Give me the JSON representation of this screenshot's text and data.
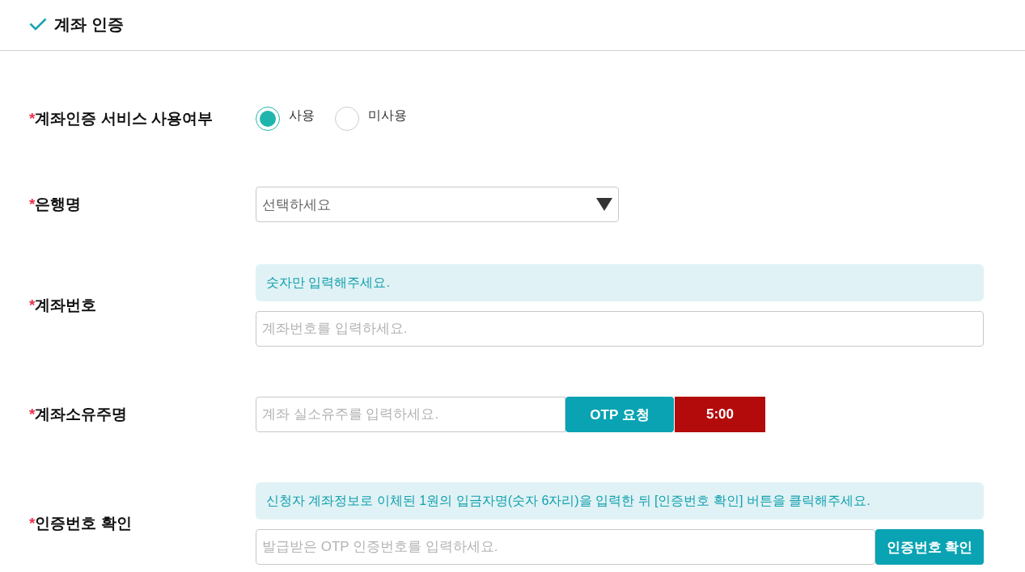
{
  "section": {
    "title": "계좌 인증"
  },
  "fields": [
    {
      "kind": "radio",
      "required_mark": "*",
      "label": "계좌인증 서비스 사용여부",
      "options": [
        {
          "label": "사용",
          "selected": true
        },
        {
          "label": "미사용",
          "selected": false
        }
      ]
    },
    {
      "kind": "select",
      "required_mark": "*",
      "label": "은행명",
      "placeholder": "선택하세요"
    },
    {
      "kind": "text",
      "required_mark": "*",
      "label": "계좌번호",
      "notice": "숫자만 입력해주세요.",
      "placeholder": "계좌번호를 입력하세요."
    },
    {
      "kind": "otp",
      "required_mark": "*",
      "label": "계좌소유주명",
      "placeholder": "계좌 실소유주를 입력하세요.",
      "button": "OTP 요청",
      "timer": "5:00"
    },
    {
      "kind": "verify",
      "required_mark": "*",
      "label": "인증번호 확인",
      "notice": "신청자 계좌정보로 이체된 1원의 입금자명(숫자 6자리)을 입력한 뒤 [인증번호 확인] 버튼을 클릭해주세요.",
      "placeholder": "발급받은 OTP 인증번호를 입력하세요.",
      "button": "인증번호 확인"
    }
  ]
}
